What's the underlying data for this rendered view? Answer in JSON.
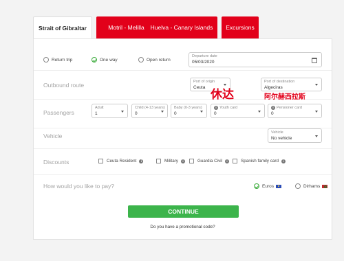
{
  "tabs": [
    {
      "label": "Strait of Gibraltar",
      "active": true
    },
    {
      "label": "Motril - Melilla",
      "active": false
    },
    {
      "label": "Huelva - Canary Islands",
      "active": false
    },
    {
      "label": "Excursions",
      "active": false
    }
  ],
  "trip": {
    "options": [
      "Return trip",
      "One way",
      "Open return"
    ],
    "selected": "One way",
    "departure_label": "Departure date",
    "departure_value": "05/03/2020"
  },
  "outbound": {
    "label": "Outbound route",
    "origin_label": "Port of origin",
    "origin_value": "Ceuta",
    "origin_overlay": "休达",
    "destination_label": "Port of destination",
    "destination_value": "Algeciras",
    "destination_overlay": "阿尔赫西拉斯"
  },
  "passengers": {
    "label": "Passengers",
    "adult_label": "Adult",
    "adult_value": "1",
    "child_label": "Child (4-13 years)",
    "child_value": "0",
    "baby_label": "Baby (0-3 years)",
    "baby_value": "0",
    "youth_label": "Youth card",
    "youth_value": "0",
    "pensioner_label": "Pensioner card",
    "pensioner_value": "0"
  },
  "vehicle": {
    "label": "Vehicle",
    "field_label": "Vehicle",
    "field_value": "No vehicle"
  },
  "discounts": {
    "label": "Discounts",
    "items": [
      "Ceuta Resident",
      "Military",
      "Guardia Civil",
      "Spanish family card"
    ]
  },
  "payment": {
    "question": "How would you like to pay?",
    "options": [
      "Euros",
      "Dirhams"
    ],
    "selected": "Euros"
  },
  "actions": {
    "continue_label": "CONTINUE",
    "promo_label": "Do you have a promotional code?"
  },
  "colors": {
    "accent_red": "#e2001a",
    "continue_green": "#3cb44b",
    "check_green": "#3cac3c",
    "overlay_text": "#e2001a"
  }
}
